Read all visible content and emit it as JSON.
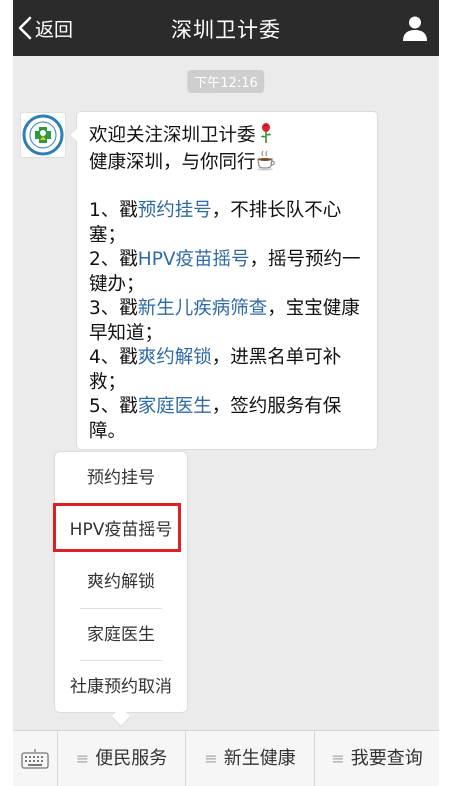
{
  "header": {
    "back_label": "返回",
    "title": "深圳卫计委"
  },
  "chat": {
    "timestamp": "下午12:16",
    "message": {
      "line1": "欢迎关注深圳卫计委",
      "line2": "健康深圳，与你同行",
      "items": [
        {
          "prefix": "1、戳",
          "link": "预约挂号",
          "suffix": "，不排长队不心塞；"
        },
        {
          "prefix": "2、戳",
          "link": "HPV疫苗摇号",
          "suffix": "，摇号预约一键办；"
        },
        {
          "prefix": "3、戳",
          "link": "新生儿疾病筛查",
          "suffix": "，宝宝健康早知道；"
        },
        {
          "prefix": "4、戳",
          "link": "爽约解锁",
          "suffix": "，进黑名单可补救；"
        },
        {
          "prefix": "5、戳",
          "link": "家庭医生",
          "suffix": "，签约服务有保障。"
        }
      ]
    }
  },
  "popup_menu": {
    "items": [
      "预约挂号",
      "HPV疫苗摇号",
      "爽约解锁",
      "家庭医生",
      "社康预约取消"
    ],
    "highlighted": "HPV疫苗摇号",
    "highlight_color": "#e02020"
  },
  "menu_bar": {
    "items": [
      "便民服务",
      "新生健康",
      "我要查询"
    ],
    "hamburger": "≡"
  },
  "colors": {
    "header_bg": "#2b2b2b",
    "chat_bg": "#ebebeb",
    "link": "#2f6aa8"
  },
  "icons": [
    "back-chevron-icon",
    "profile-icon",
    "rose-emoji-icon",
    "coffee-emoji-icon",
    "keyboard-icon"
  ]
}
